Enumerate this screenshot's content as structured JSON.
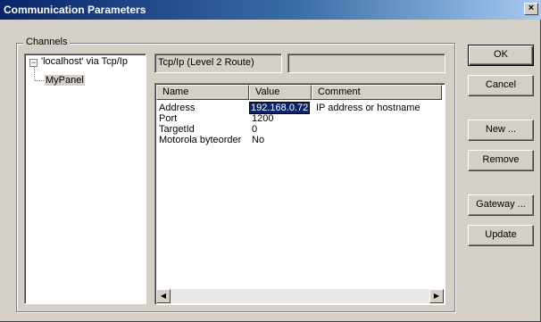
{
  "window": {
    "title": "Communication Parameters",
    "close_glyph": "×"
  },
  "channels": {
    "group_label": "Channels",
    "tree": [
      {
        "label": "'localhost' via Tcp/Ip",
        "expander": "−"
      },
      {
        "label": "MyPanel"
      }
    ]
  },
  "route": {
    "protocol_field": "Tcp/Ip (Level 2 Route)",
    "second_field": ""
  },
  "params": {
    "columns": [
      "Name",
      "Value",
      "Comment"
    ],
    "rows": [
      {
        "name": "Address",
        "value": "192.168.0.72",
        "comment": "IP address or hostname"
      },
      {
        "name": "Port",
        "value": "1200",
        "comment": ""
      },
      {
        "name": "TargetId",
        "value": "0",
        "comment": ""
      },
      {
        "name": "Motorola byteorder",
        "value": "No",
        "comment": ""
      }
    ],
    "scroll_left_glyph": "◀",
    "scroll_right_glyph": "▶"
  },
  "buttons": {
    "ok": "OK",
    "cancel": "Cancel",
    "new": "New ...",
    "remove": "Remove",
    "gateway": "Gateway ...",
    "update": "Update"
  },
  "colors": {
    "title_active": "#0a246a",
    "face": "#d4d0c8",
    "selection": "#0a246a"
  }
}
